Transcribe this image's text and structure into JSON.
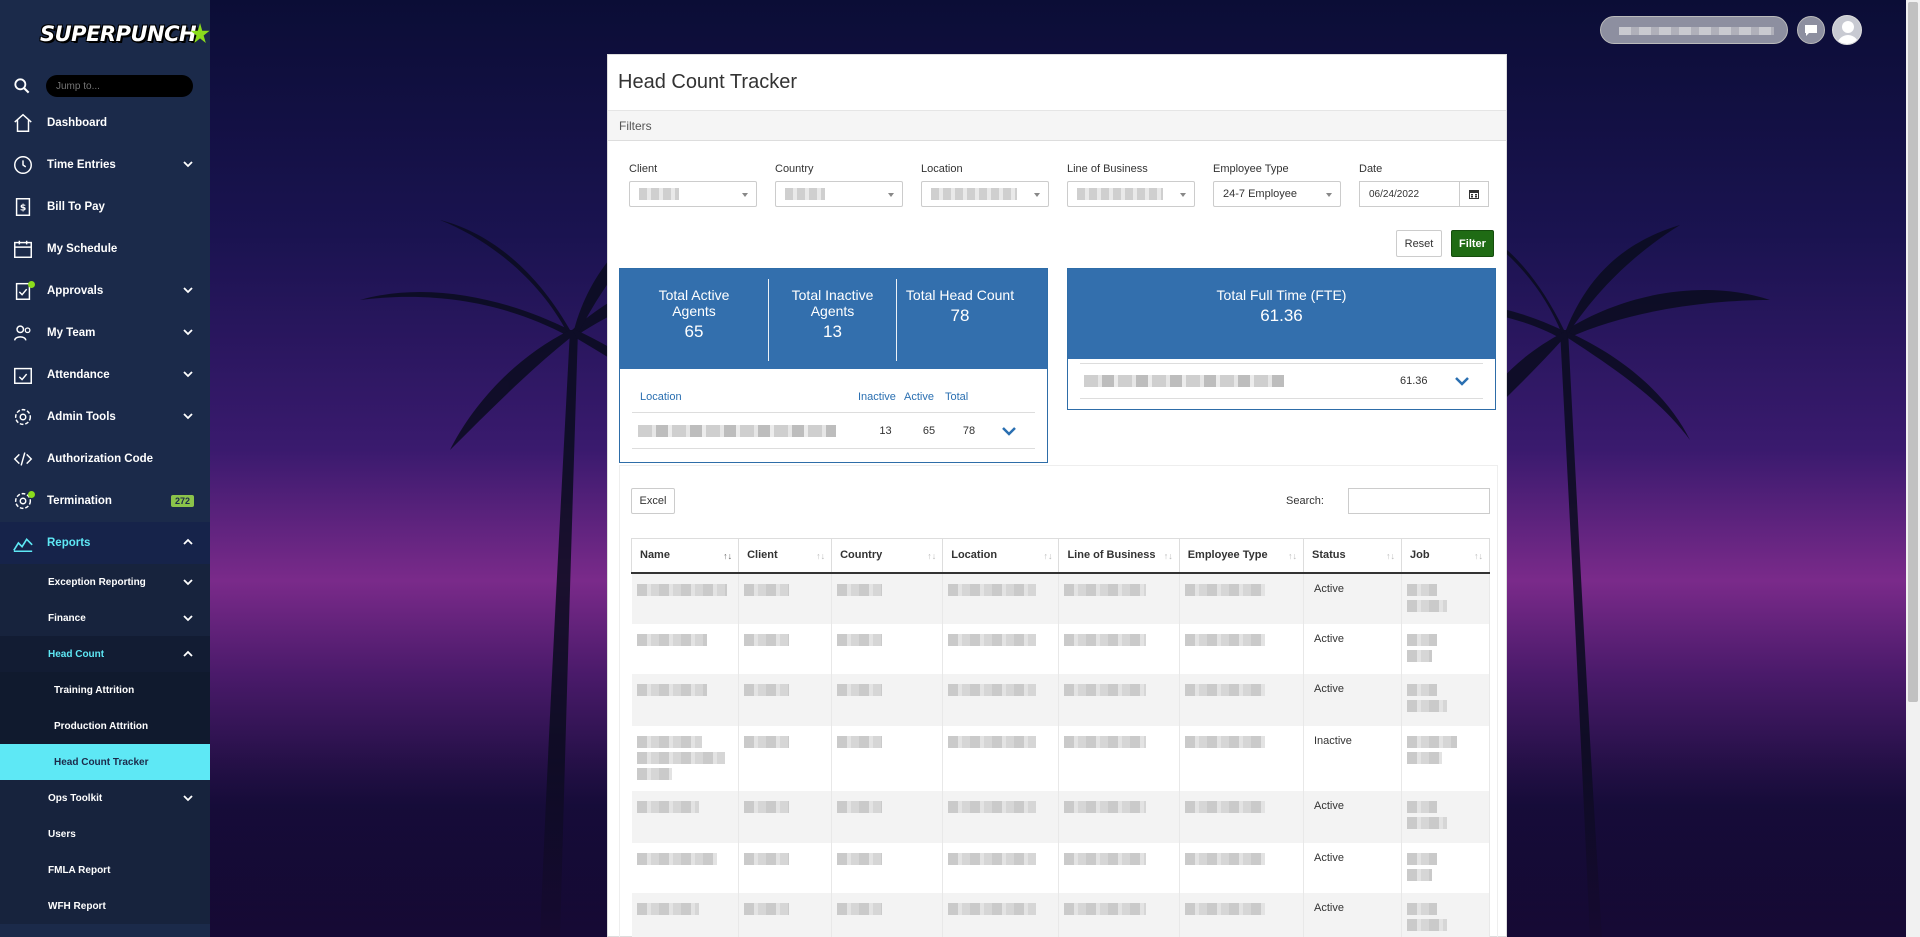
{
  "brand": {
    "name": "SUPERPUNCH"
  },
  "sidebar": {
    "search_placeholder": "Jump to...",
    "items": [
      {
        "label": "Dashboard",
        "icon": "home-icon",
        "has_chevron": false
      },
      {
        "label": "Time Entries",
        "icon": "clock-icon",
        "has_chevron": true
      },
      {
        "label": "Bill To Pay",
        "icon": "invoice-icon",
        "has_chevron": false
      },
      {
        "label": "My Schedule",
        "icon": "calendar-icon",
        "has_chevron": false
      },
      {
        "label": "Approvals",
        "icon": "clipboard-check-icon",
        "has_chevron": true
      },
      {
        "label": "My Team",
        "icon": "team-icon",
        "has_chevron": true
      },
      {
        "label": "Attendance",
        "icon": "calendar-check-icon",
        "has_chevron": true
      },
      {
        "label": "Admin Tools",
        "icon": "gear-icon",
        "has_chevron": true
      },
      {
        "label": "Authorization Code",
        "icon": "code-icon",
        "has_chevron": false
      },
      {
        "label": "Termination",
        "icon": "gear-badge-icon",
        "badge": "272"
      },
      {
        "label": "Reports",
        "icon": "chart-icon",
        "has_chevron": true
      }
    ],
    "reports_sub": [
      {
        "label": "Exception Reporting"
      },
      {
        "label": "Finance"
      },
      {
        "label": "Head Count"
      },
      {
        "label": "Training Attrition"
      },
      {
        "label": "Production Attrition"
      },
      {
        "label": "Head Count Tracker"
      },
      {
        "label": "Ops Toolkit"
      },
      {
        "label": "Users"
      },
      {
        "label": "FMLA Report"
      },
      {
        "label": "WFH Report"
      }
    ]
  },
  "page": {
    "title": "Head Count Tracker",
    "filters_label": "Filters",
    "filters": {
      "client_label": "Client",
      "country_label": "Country",
      "location_label": "Location",
      "lob_label": "Line of Business",
      "employee_type_label": "Employee Type",
      "employee_type_value": "24-7 Employee",
      "date_label": "Date",
      "date_value": "06/24/2022"
    },
    "reset_label": "Reset",
    "filter_label": "Filter"
  },
  "summary": {
    "active_label": "Total Active Agents",
    "active_value": "65",
    "inactive_label": "Total Inactive Agents",
    "inactive_value": "13",
    "head_label": "Total Head Count",
    "head_value": "78",
    "loc_headers": {
      "location": "Location",
      "inactive": "Inactive",
      "active": "Active",
      "total": "Total"
    },
    "loc_row": {
      "inactive": "13",
      "active": "65",
      "total": "78"
    },
    "fte_label": "Total Full Time (FTE)",
    "fte_value": "61.36",
    "fte_row_value": "61.36"
  },
  "table": {
    "excel_label": "Excel",
    "search_label": "Search:",
    "columns": [
      "Name",
      "Client",
      "Country",
      "Location",
      "Line of Business",
      "Employee Type",
      "Status",
      "Job"
    ],
    "rows": [
      {
        "status": "Active"
      },
      {
        "status": "Active"
      },
      {
        "status": "Active"
      },
      {
        "status": "Inactive"
      },
      {
        "status": "Active"
      },
      {
        "status": "Active"
      },
      {
        "status": "Active"
      }
    ]
  },
  "colors": {
    "sidebar_bg": "#1b2a4a",
    "accent_cyan": "#5ee8f5",
    "stat_blue": "#336fad",
    "filter_green": "#1f6b14"
  }
}
